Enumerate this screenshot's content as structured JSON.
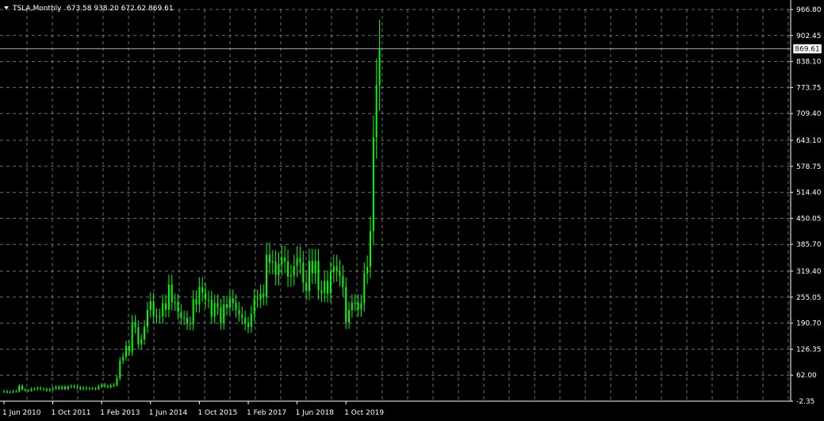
{
  "header": {
    "symbol": "TSLA,Monthly",
    "ohlc": "673.58 938.20 672.62 869.61",
    "collapse_icon": "triangle-down-icon"
  },
  "current_price_label": "869.61",
  "colors": {
    "background": "#000000",
    "grid": "#9aa0a6",
    "candle": "#00ff00",
    "text": "#ffffff",
    "price_line": "#8aa2b8"
  },
  "chart_data": {
    "type": "candlestick",
    "title": "TSLA,Monthly",
    "ylim": [
      -2.35,
      966.8
    ],
    "grid": true,
    "y_tick_labels": [
      "966.80",
      "902.45",
      "838.10",
      "773.75",
      "709.40",
      "643.10",
      "578.75",
      "514.40",
      "450.05",
      "385.70",
      "319.40",
      "255.05",
      "190.70",
      "126.35",
      "62.00",
      "-2.35"
    ],
    "x_tick_labels": [
      "1 Jun 2010",
      "1 Oct 2011",
      "1 Feb 2013",
      "1 Jun 2014",
      "1 Oct 2015",
      "1 Feb 2017",
      "1 Jun 2018",
      "1 Oct 2019"
    ],
    "current_price": 869.61,
    "series": [
      {
        "start": "2010-06",
        "close": [
          21.9,
          19.2,
          20.5,
          21.9,
          21.8,
          35.3,
          26.6,
          24.1,
          23.9,
          27.8,
          27.6,
          30.0,
          27.5,
          27.2,
          24.1,
          26.6,
          29.4,
          32.7,
          28.6,
          33.1,
          27.9,
          33.1,
          34.4,
          32.8,
          31.1,
          27.4,
          30.3,
          28.2,
          29.3,
          28.6,
          27.8,
          33.9,
          37.6,
          34.5,
          32.7,
          36.4,
          37.8,
          54.1,
          97.8,
          107.4,
          134.3,
          120.1,
          193.4,
          180.9,
          138.3,
          150.4,
          181.4,
          223.4,
          244.8,
          208.5,
          207.9,
          207.3,
          240.1,
          224.0,
          286.0,
          242.7,
          241.7,
          218.3,
          203.6,
          203.3,
          190.0,
          188.8,
          250.0,
          236.8,
          280.0,
          266.2,
          248.4,
          249.1,
          206.9,
          240.0,
          230.3,
          191.2,
          237.2,
          229.0,
          251.9,
          240.8,
          223.4,
          212.3,
          204.0,
          189.4,
          181.9,
          213.7,
          251.9,
          250.0,
          263.1,
          256.0,
          360.0,
          340.0,
          342.4,
          310.0,
          336.8,
          352.6,
          343.0,
          306.0,
          308.9,
          331.5,
          351.3,
          340.4,
          290.8,
          270.3,
          345.0,
          314.0,
          344.3,
          272.0,
          265.0,
          295.0,
          264.1,
          316.8,
          331.2,
          319.8,
          307.8,
          279.9,
          193.0,
          223.5,
          240.9,
          241.6,
          225.2,
          240.2,
          314.3,
          329.9,
          418.3,
          650.6,
          780.0,
          869.6
        ]
      }
    ]
  }
}
